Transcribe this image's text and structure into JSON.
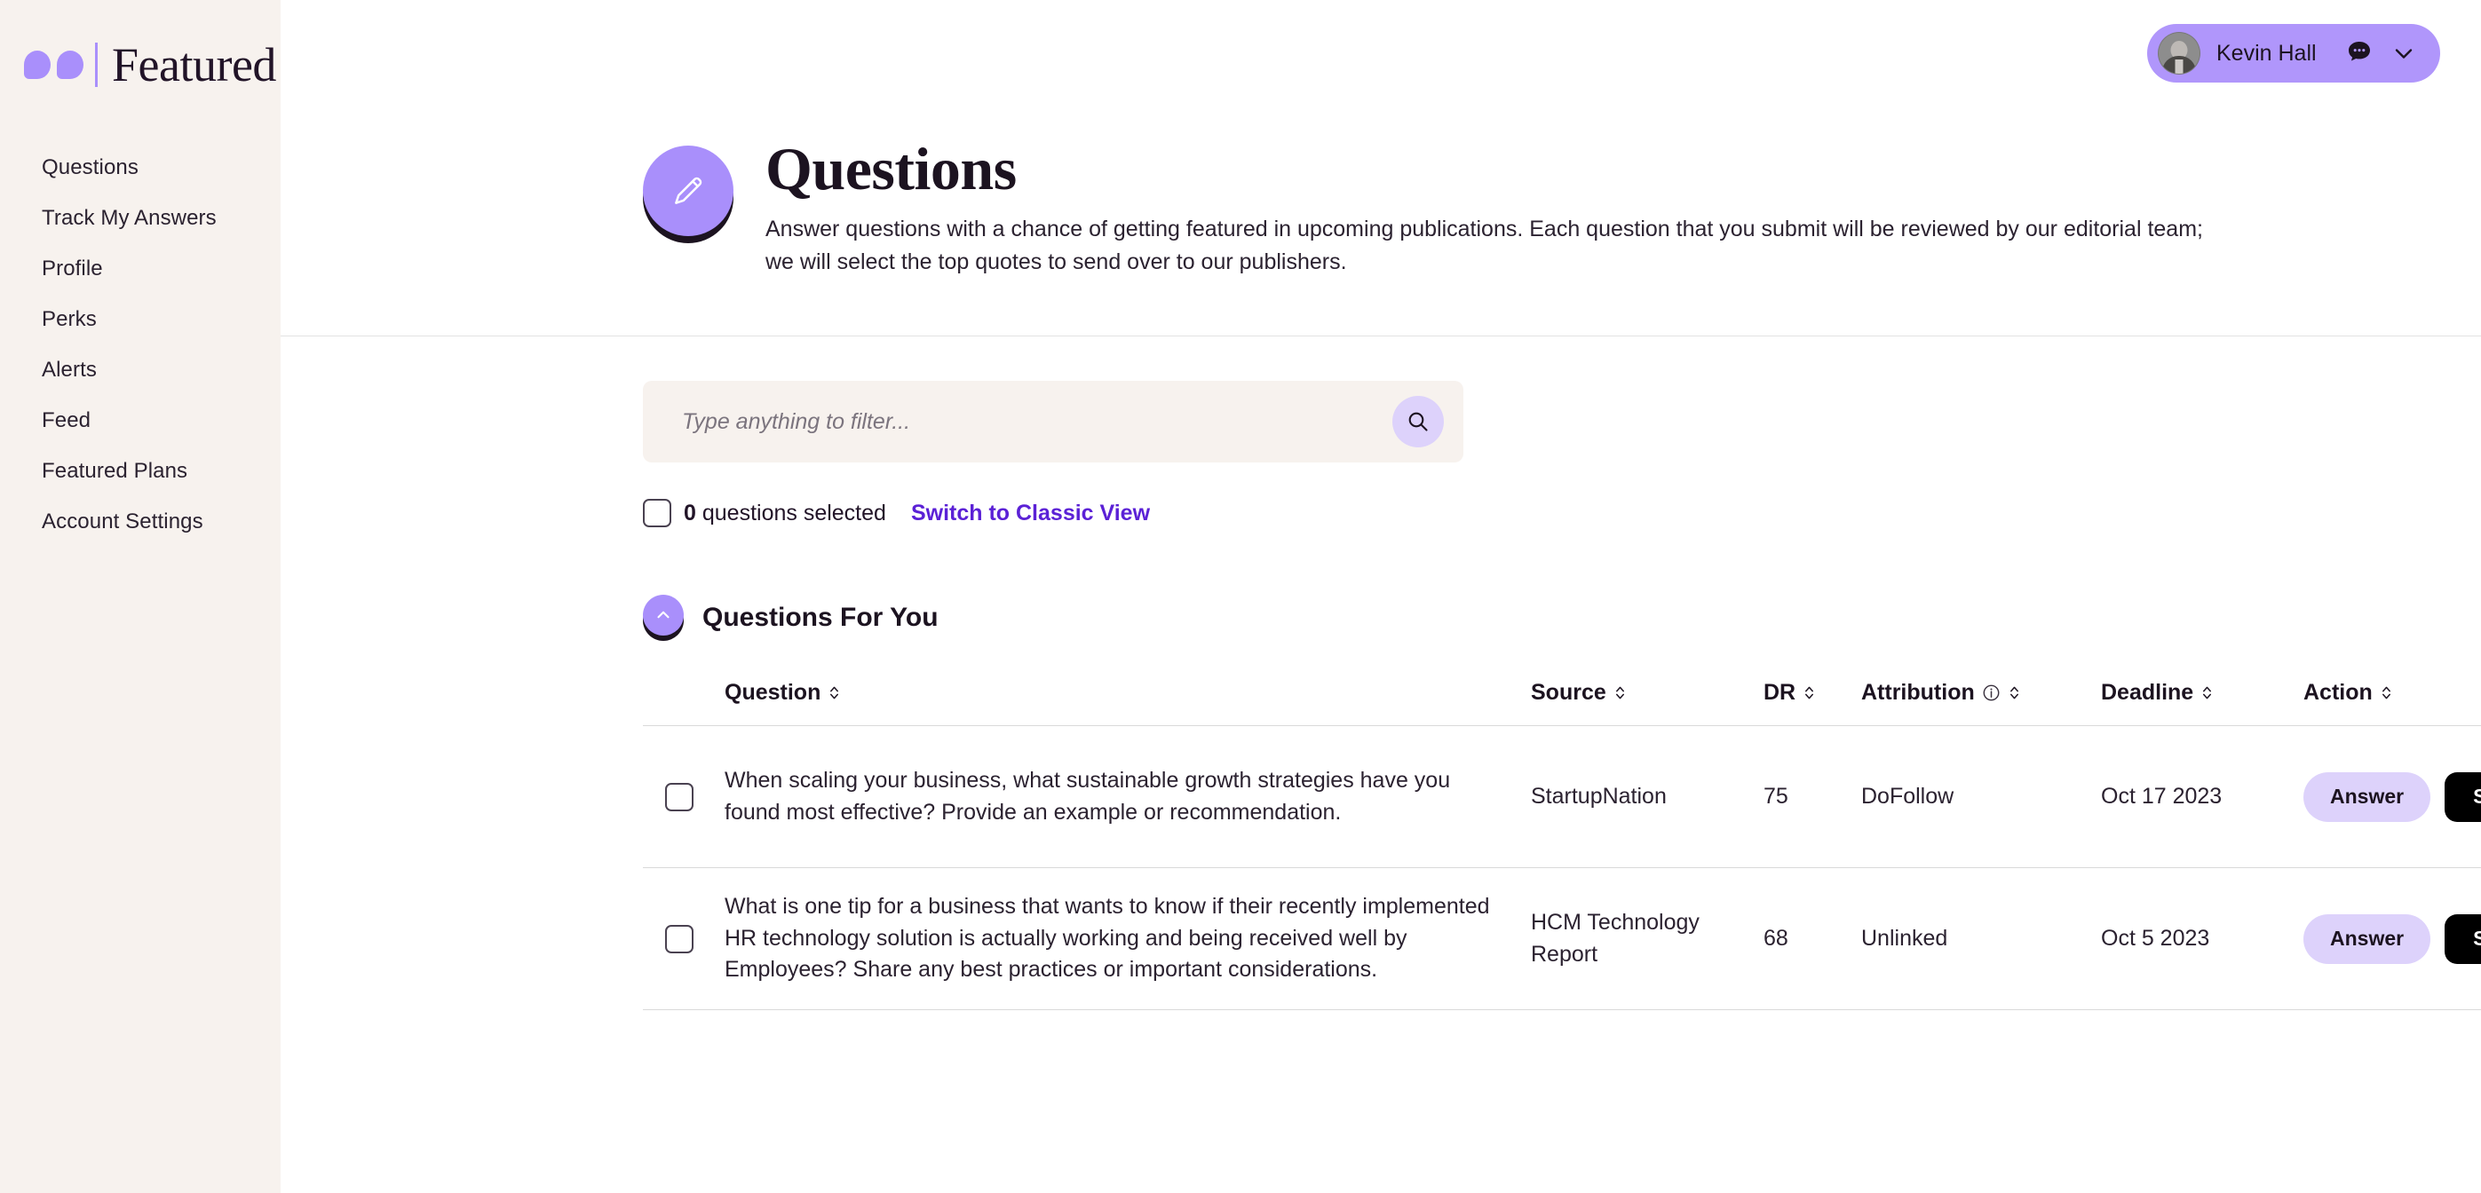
{
  "brand": {
    "name": "Featured",
    "quote_icon": "quote-marks-icon"
  },
  "sidebar": {
    "items": [
      {
        "label": "Questions"
      },
      {
        "label": "Track My Answers"
      },
      {
        "label": "Profile"
      },
      {
        "label": "Perks"
      },
      {
        "label": "Alerts"
      },
      {
        "label": "Feed"
      },
      {
        "label": "Featured Plans"
      },
      {
        "label": "Account Settings"
      }
    ]
  },
  "topbar": {
    "user_name": "Kevin Hall",
    "chat_icon": "chat-bubble-icon",
    "chevron_icon": "chevron-down-icon",
    "avatar_icon": "user-avatar"
  },
  "page": {
    "icon": "pencil-icon",
    "title": "Questions",
    "description": "Answer questions with a chance of getting featured in upcoming publications. Each question that you submit will be reviewed by our editorial team; we will select the top quotes to send over to our publishers."
  },
  "filter": {
    "placeholder": "Type anything to filter...",
    "value": "",
    "search_icon": "search-icon",
    "selected_count": "0",
    "selected_label": "questions selected",
    "switch_view_label": "Switch to Classic View"
  },
  "section": {
    "title": "Questions For You",
    "collapse_icon": "chevron-up-icon"
  },
  "table": {
    "headers": {
      "question": "Question",
      "source": "Source",
      "dr": "DR",
      "attribution": "Attribution",
      "deadline": "Deadline",
      "action": "Action",
      "info_icon": "info-circle-icon",
      "sort_icon": "sort-updown-icon"
    },
    "rows": [
      {
        "question": "When scaling your business, what sustainable growth strategies have you found most effective? Provide an example or recommendation.",
        "source": "StartupNation",
        "dr": "75",
        "attribution": "DoFollow",
        "deadline": "Oct 17 2023",
        "answer_label": "Answer",
        "skip_label": "Skip",
        "mail_icon": "envelope-icon"
      },
      {
        "question": "What is one tip for a business that wants to know if their recently implemented HR technology solution is actually working and being received well by Employees? Share any best practices or important considerations.",
        "source": "HCM Technology Report",
        "dr": "68",
        "attribution": "Unlinked",
        "deadline": "Oct 5 2023",
        "answer_label": "Answer",
        "skip_label": "Skip",
        "mail_icon": "envelope-icon"
      }
    ]
  },
  "colors": {
    "accent_purple": "#A98FFB",
    "light_purple": "#DDD2FB",
    "pill_purple": "#B096FB",
    "sidebar_bg": "#F7F2EE",
    "link_purple": "#5B21D6",
    "text_dark": "#1C1320"
  }
}
